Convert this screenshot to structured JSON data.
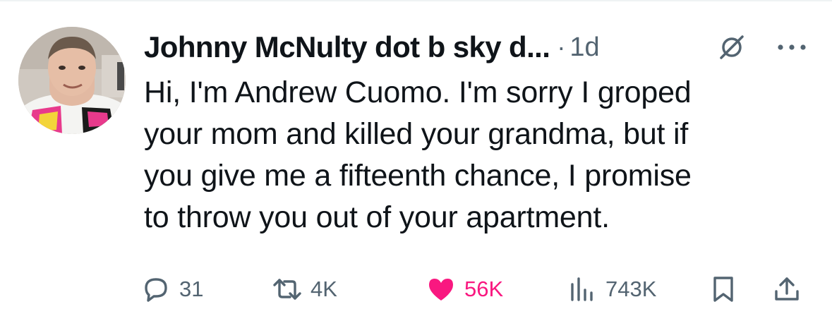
{
  "tweet": {
    "author_name": "Johnny McNulty dot b sky d...",
    "separator": "·",
    "time": "1d",
    "text": "Hi, I'm Andrew Cuomo. I'm sorry I groped\nyour mom and killed your grandma, but if\nyou give me a fifteenth chance, I promise\nto throw you out of your apartment."
  },
  "icons": {
    "grok": "grok-slash-circle-icon",
    "more": "more-horizontal-icon",
    "reply": "reply-bubble-icon",
    "repost": "repost-arrows-icon",
    "like": "heart-icon",
    "views": "analytics-bars-icon",
    "bookmark": "bookmark-icon",
    "share": "share-upload-icon"
  },
  "actions": {
    "replies": "31",
    "reposts": "4K",
    "likes": "56K",
    "views": "743K"
  },
  "colors": {
    "text": "#0f1419",
    "secondary": "#536471",
    "like": "#f91880"
  }
}
